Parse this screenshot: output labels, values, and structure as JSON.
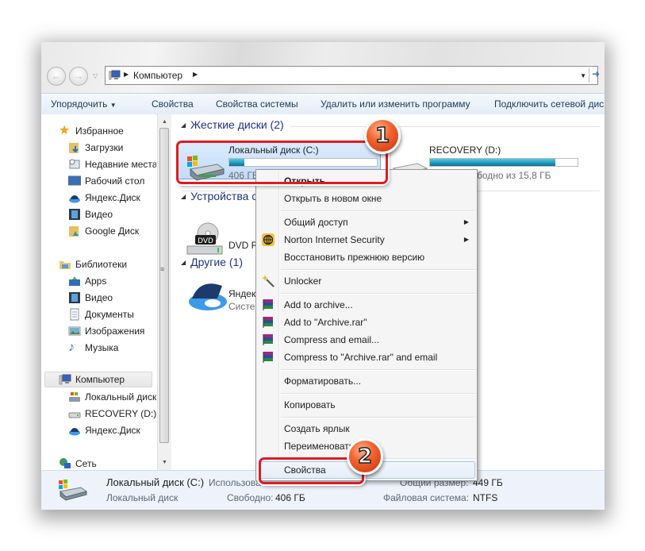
{
  "address_bar": {
    "breadcrumb": "Компьютер"
  },
  "toolbar": {
    "organize": "Упорядочить",
    "properties": "Свойства",
    "system_properties": "Свойства системы",
    "uninstall": "Удалить или изменить программу",
    "map_drive": "Подключить сетевой дис"
  },
  "sidebar": {
    "favorites": {
      "label": "Избранное",
      "items": [
        "Загрузки",
        "Недавние места",
        "Рабочий стол",
        "Яндекс.Диск",
        "Видео",
        "Google Диск"
      ]
    },
    "libraries": {
      "label": "Библиотеки",
      "items": [
        "Apps",
        "Видео",
        "Документы",
        "Изображения",
        "Музыка"
      ]
    },
    "computer": {
      "label": "Компьютер",
      "items": [
        "Локальный диск",
        "RECOVERY (D:)",
        "Яндекс.Диск"
      ]
    },
    "network": {
      "label": "Сеть"
    }
  },
  "content": {
    "groups": [
      {
        "label": "Жесткие диски (2)"
      },
      {
        "label": "Устройства с"
      },
      {
        "label": "Другие (1)"
      }
    ],
    "drives": {
      "c": {
        "name": "Локальный диск (C:)",
        "free_text": "406 ГБ",
        "used_fraction": 0.1
      },
      "d": {
        "name": "RECOVERY (D:)",
        "free_text": "бодно из 15,8 ГБ",
        "used_fraction": 0.85
      }
    },
    "dvd": {
      "name": "DVD R"
    },
    "yandex": {
      "name": "Яндекс",
      "sub": "Систе"
    }
  },
  "context_menu": {
    "items": [
      {
        "label": "Открыть"
      },
      {
        "label": "Открыть в новом окне"
      },
      {
        "label": "Общий доступ",
        "submenu": true
      },
      {
        "label": "Norton Internet Security",
        "submenu": true
      },
      {
        "label": "Восстановить прежнюю версию"
      },
      {
        "label": "Unlocker"
      },
      {
        "label": "Add to archive..."
      },
      {
        "label": "Add to \"Archive.rar\""
      },
      {
        "label": "Compress and email..."
      },
      {
        "label": "Compress to \"Archive.rar\" and email"
      },
      {
        "label": "Форматировать..."
      },
      {
        "label": "Копировать"
      },
      {
        "label": "Создать ярлык"
      },
      {
        "label": "Переименовать"
      },
      {
        "label": "Свойства"
      }
    ]
  },
  "status_bar": {
    "name": "Локальный диск (C:)",
    "type": "Локальный диск",
    "used_label": "Использова",
    "free_label": "Свободно:",
    "free_value": "406 ГБ",
    "total_label": "Общий размер:",
    "total_value": "449 ГБ",
    "fs_label": "Файловая система:",
    "fs_value": "NTFS"
  },
  "annotations": {
    "step1": "1",
    "step2": "2",
    "accent_color": "#e11b22"
  },
  "icons": {
    "arrow_right": "▸",
    "triangle_down": "▼",
    "triangle_up": "▲",
    "back": "←",
    "forward": "→"
  }
}
